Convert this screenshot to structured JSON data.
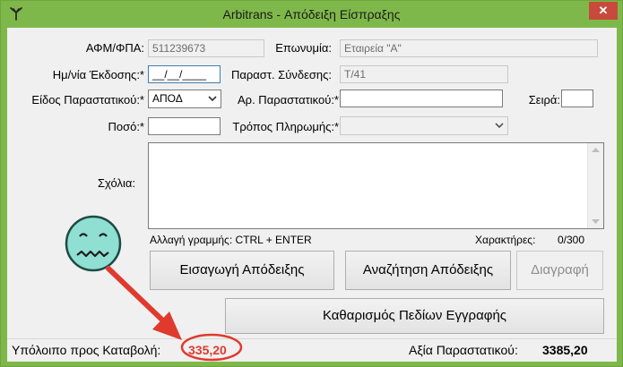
{
  "window": {
    "title": "Arbitrans - Απόδειξη Είσπραξης",
    "close_label": "✕"
  },
  "form": {
    "afm_label": "ΑΦΜ/ΦΠΑ:",
    "afm_value": "511239673",
    "eponymia_label": "Επωνυμία:",
    "eponymia_value": "Εταιρεία \"Α\"",
    "date_label": "Ημ/νία Έκδοσης:*",
    "date_value": "__/__/____",
    "parast_syndesis_label": "Παραστ. Σύνδεσης:",
    "parast_syndesis_value": "Τ/41",
    "eidos_label": "Είδος Παραστατικού:*",
    "eidos_value": "ΑΠΟΔ",
    "ar_parast_label": "Αρ. Παραστατικού:*",
    "ar_parast_value": "",
    "seira_label": "Σειρά:",
    "seira_value": "",
    "poso_label": "Ποσό:*",
    "poso_value": "",
    "tropos_label": "Τρόπος Πληρωμής:*",
    "tropos_value": "",
    "sxolia_label": "Σχόλια:",
    "hint_text": "Αλλαγή γραμμής: CTRL + ENTER",
    "chars_label": "Χαρακτήρες:",
    "chars_value": "0/300"
  },
  "buttons": {
    "insert": "Εισαγωγή Απόδειξης",
    "search": "Αναζήτηση Απόδειξης",
    "delete": "Διαγραφή",
    "clear": "Καθαρισμός Πεδίων Εγγραφής"
  },
  "status": {
    "balance_label": "Υπόλοιπο προς Καταβολή:",
    "balance_value": "335,20",
    "value_label": "Αξία Παραστατικού:",
    "value_value": "3385,20"
  },
  "colors": {
    "frame": "#7fb84a",
    "annotation": "#e03a2e",
    "close": "#c74a3c"
  },
  "icons": [
    "app-bird-icon",
    "close-icon",
    "chevron-down-icon",
    "sick-face-icon",
    "arrow-annotation"
  ]
}
